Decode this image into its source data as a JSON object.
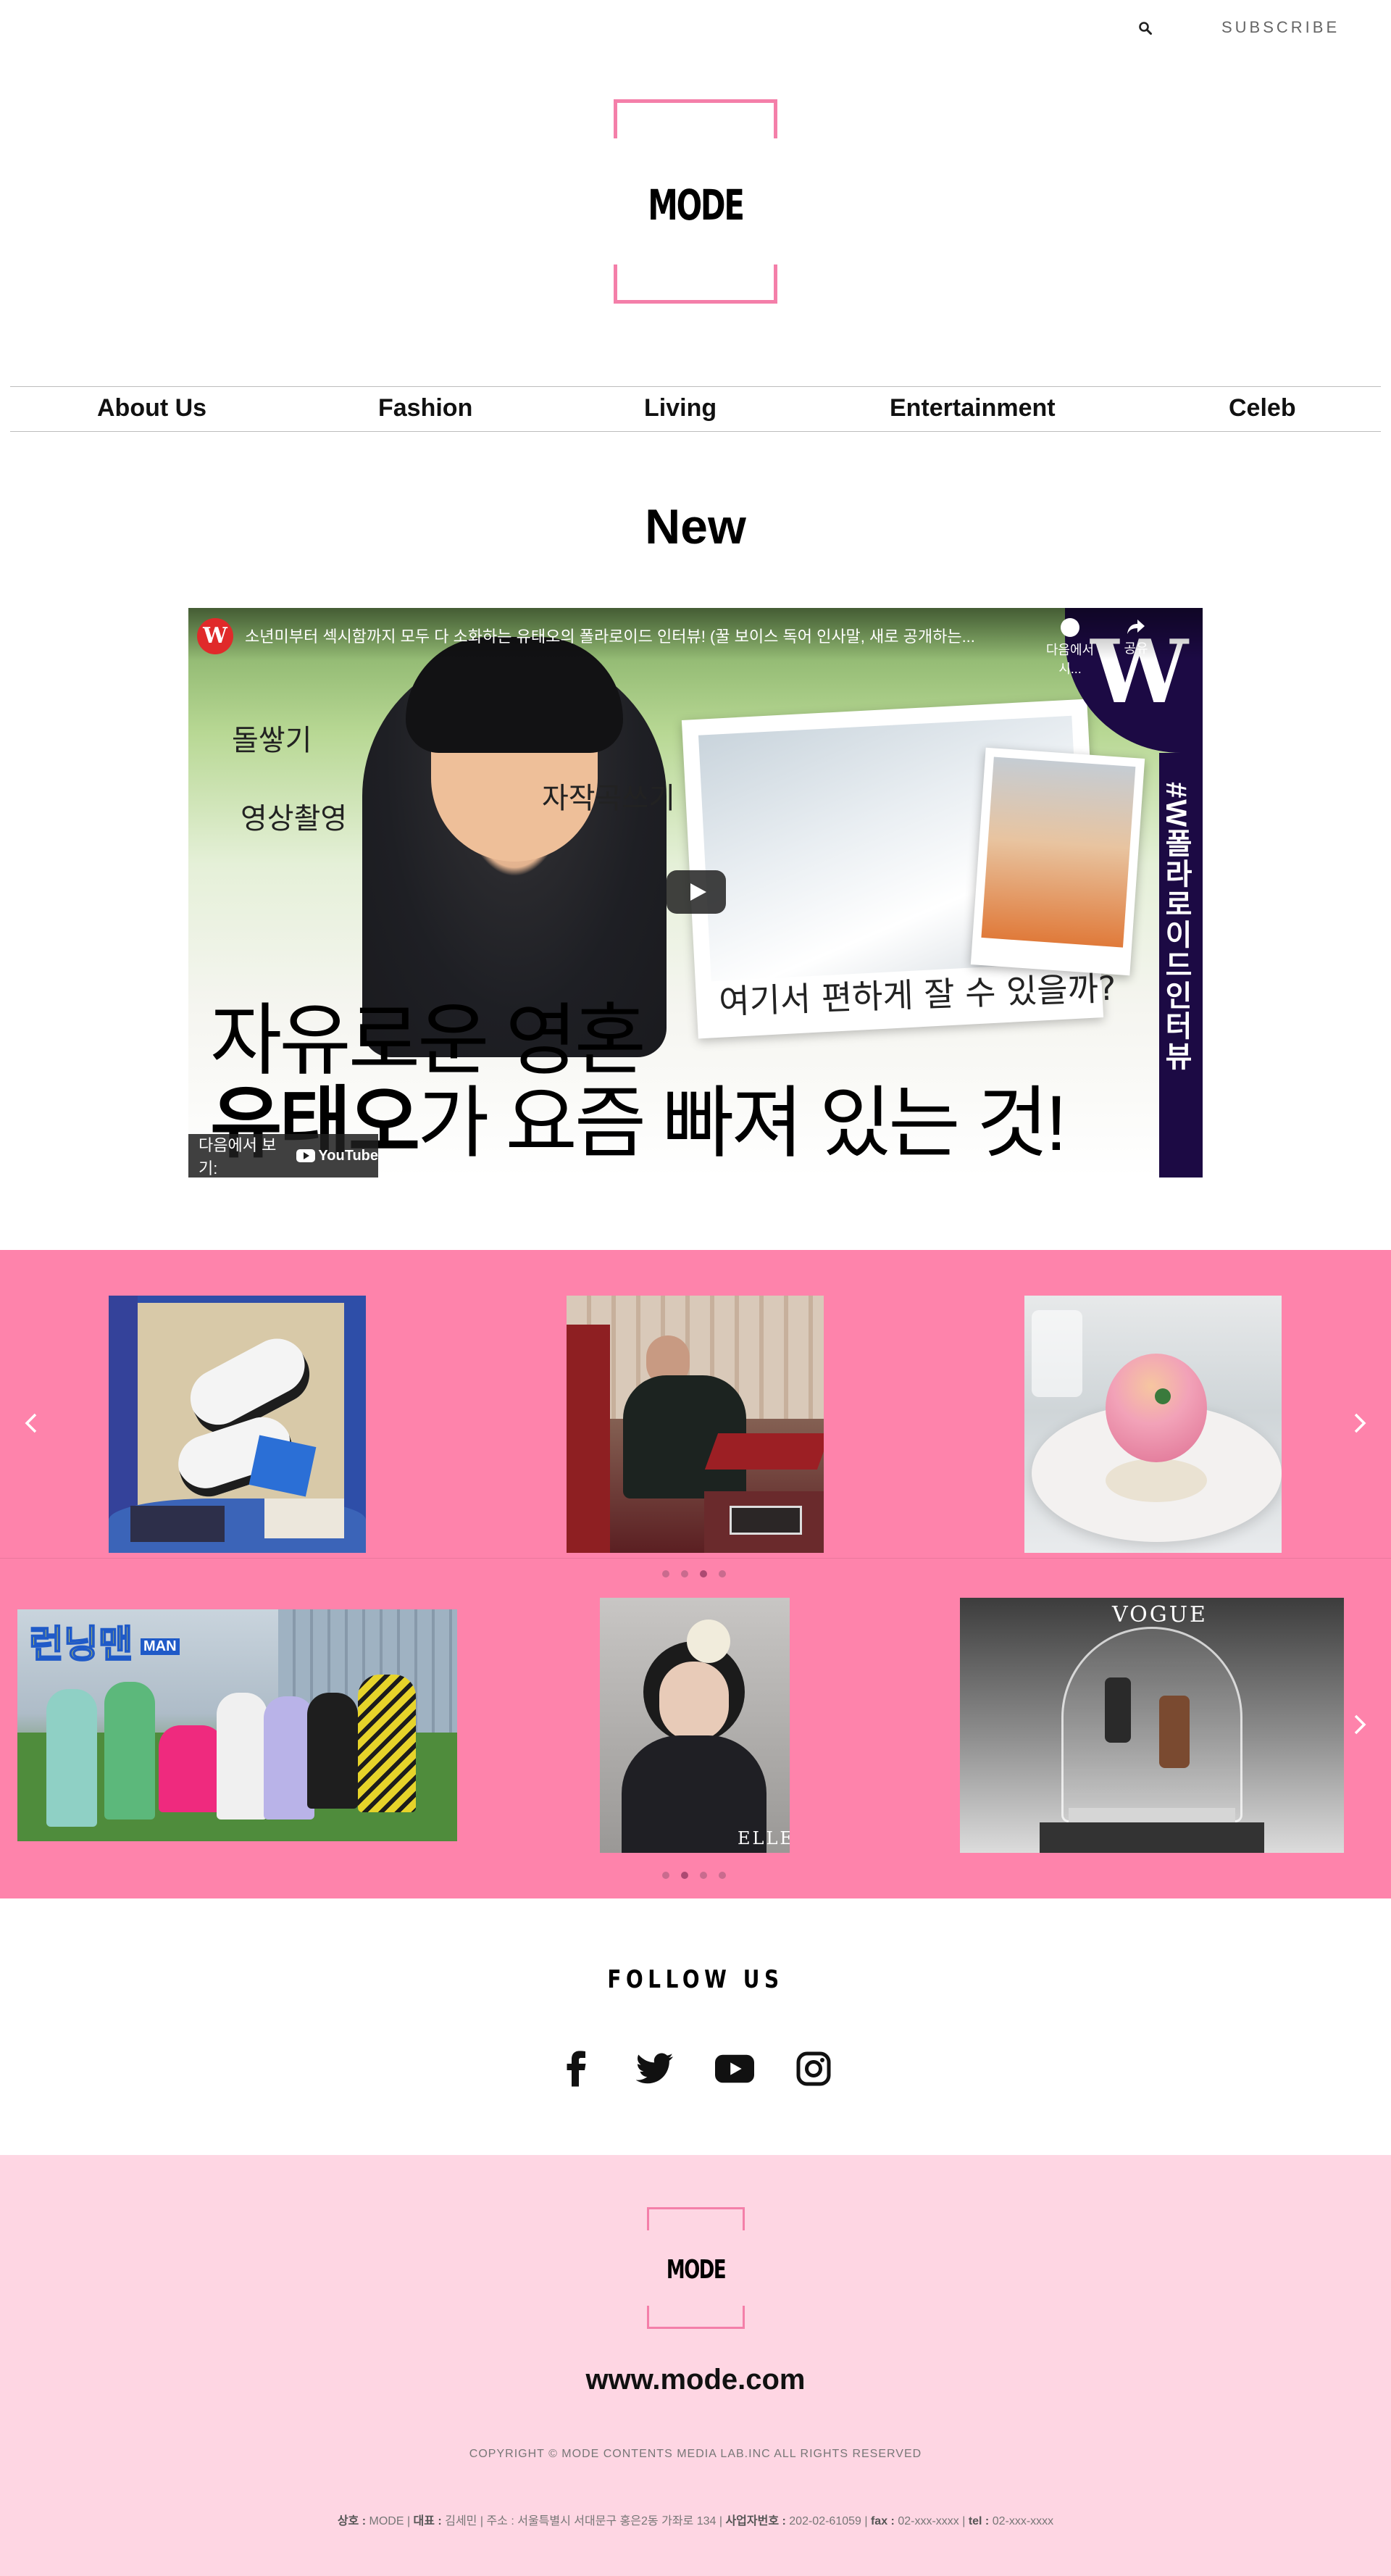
{
  "header": {
    "search_icon": "search-icon",
    "subscribe_label": "SUBSCRIBE",
    "logo_text": "MODE",
    "brand_color": "#f47fa9"
  },
  "nav": {
    "items": [
      {
        "label": "About Us"
      },
      {
        "label": "Fashion"
      },
      {
        "label": "Living"
      },
      {
        "label": "Entertainment"
      },
      {
        "label": "Celeb"
      }
    ]
  },
  "section": {
    "title": "New"
  },
  "video": {
    "channel_logo": "W",
    "title": "소년미부터 섹시함까지 모두 다 소화하는 유태오의 폴라로이드 인터뷰! (꿀 보이스 독어 인사말, 새로 공개하는...",
    "watch_later_label": "다음에서 시...",
    "share_label": "공유",
    "side_strip_text": "#W폴라로이드인터뷰",
    "handwriting": [
      "돌쌓기",
      "영상촬영",
      "자작곡쓰기",
      "여기서 편하게 잘 수 있을까?"
    ],
    "headline_line1": "자유로운 영혼",
    "headline_line2_bold": "유태오",
    "headline_line2_rest": "가 요즘 빠져 있는 것!",
    "watch_on_label": "다음에서 보기:",
    "youtube_label": "YouTube"
  },
  "carousel1": {
    "dots": 4,
    "active_dot": 3
  },
  "carousel2": {
    "dots": 4,
    "active_dot": 2,
    "captions": {
      "running_man_title": "런닝맨",
      "running_man_sub": "MAN",
      "elle": "ELLE",
      "vogue": "VOGUE"
    }
  },
  "follow": {
    "title": "FOLLOW US",
    "icons": [
      "facebook-icon",
      "twitter-icon",
      "youtube-icon",
      "instagram-icon"
    ]
  },
  "footer": {
    "logo_text": "MODE",
    "url": "www.mode.com",
    "copyright": "COPYRIGHT © MODE CONTENTS MEDIA LAB.INC ALL RIGHTS RESERVED",
    "info": {
      "company_label": "상호 : ",
      "company": "MODE",
      "ceo_label": "대표 : ",
      "ceo": "김세민",
      "address_label": "주소 : ",
      "address": "서울특별시 서대문구 홍은2동 가좌로 134",
      "bizno_label": "사업자번호 : ",
      "bizno": "202-02-61059",
      "fax_label": "fax : ",
      "fax": "02-xxx-xxxx",
      "tel_label": "tel : ",
      "tel": "02-xxx-xxxx"
    }
  },
  "colors": {
    "carousel_bg": "#fe83ab",
    "footer_bg": "#fed6e3"
  }
}
